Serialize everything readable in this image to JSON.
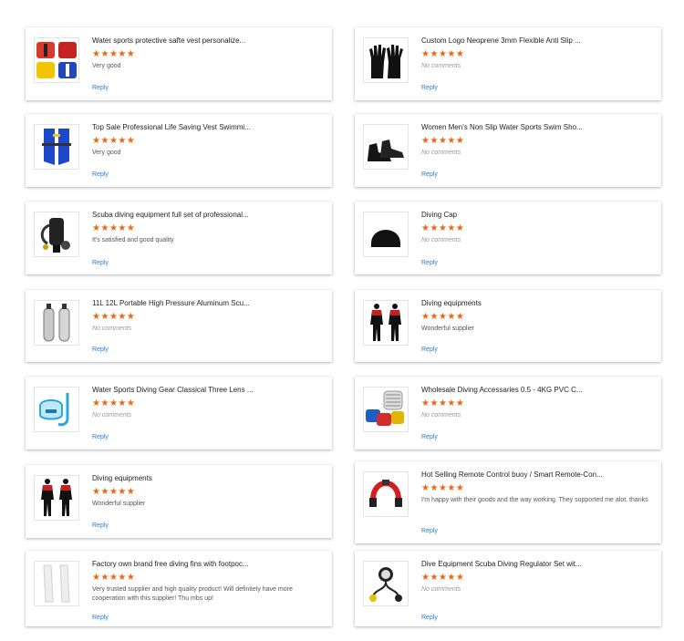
{
  "reviews": [
    {
      "title": "Water sports protective safte vest personalize...",
      "rating": 5,
      "comment": "Very good",
      "reply": "Reply",
      "icon": "life-vests-image"
    },
    {
      "title": "Custom Logo Neoprene 3mm Flexible Anti Slip ...",
      "rating": 5,
      "comment": "No comments",
      "reply": "Reply",
      "icon": "gloves-image"
    },
    {
      "title": "Top Sale Professional Life Saving Vest Swimmi...",
      "rating": 5,
      "comment": "Very good",
      "reply": "Reply",
      "icon": "inflatable-vest-image"
    },
    {
      "title": "Women Men's Non Slip Water Sports Swim Sho...",
      "rating": 5,
      "comment": "No comments",
      "reply": "Reply",
      "icon": "boots-image"
    },
    {
      "title": "Scuba diving equipment full set of professional...",
      "rating": 5,
      "comment": "It's satisfied and good quality",
      "reply": "Reply",
      "icon": "scuba-set-image"
    },
    {
      "title": "Diving Cap",
      "rating": 5,
      "comment": "No comments",
      "reply": "Reply",
      "icon": "diving-cap-image"
    },
    {
      "title": "11L 12L Portable High Pressure Aluminum Scu...",
      "rating": 5,
      "comment": "No comments",
      "reply": "Reply",
      "icon": "tanks-image"
    },
    {
      "title": "Diving equipments",
      "rating": 5,
      "comment": "Wonderful supplier",
      "reply": "Reply",
      "icon": "wetsuits-image"
    },
    {
      "title": "Water Sports Diving Gear Classical Three Lens ...",
      "rating": 5,
      "comment": "No comments",
      "reply": "Reply",
      "icon": "mask-snorkel-image"
    },
    {
      "title": "Wholesale Diving Accessaries 0.5 - 4KG PVC C...",
      "rating": 5,
      "comment": "No comments",
      "reply": "Reply",
      "icon": "weights-image"
    },
    {
      "title": "Diving equipments",
      "rating": 5,
      "comment": "Wonderful supplier",
      "reply": "Reply",
      "icon": "wetsuits-image"
    },
    {
      "title": "Hot Selling Remote Control buoy / Smart Remote-Con...",
      "rating": 5,
      "comment": "I'm happy with their goods and the way working. They supported me alot. thanks",
      "reply": "Reply",
      "icon": "buoy-image"
    },
    {
      "title": "Factory own brand free diving fins with footpoc...",
      "rating": 5,
      "comment": "Very trusted supplier and high quality product! Will definitely have more cooperation with this supplier! Thu mbs up!",
      "reply": "Reply",
      "icon": "fins-image"
    },
    {
      "title": "Dive Equipment Scuba Diving Regulator Set wit...",
      "rating": 5,
      "comment": "No comments",
      "reply": "Reply",
      "icon": "regulator-image"
    }
  ]
}
